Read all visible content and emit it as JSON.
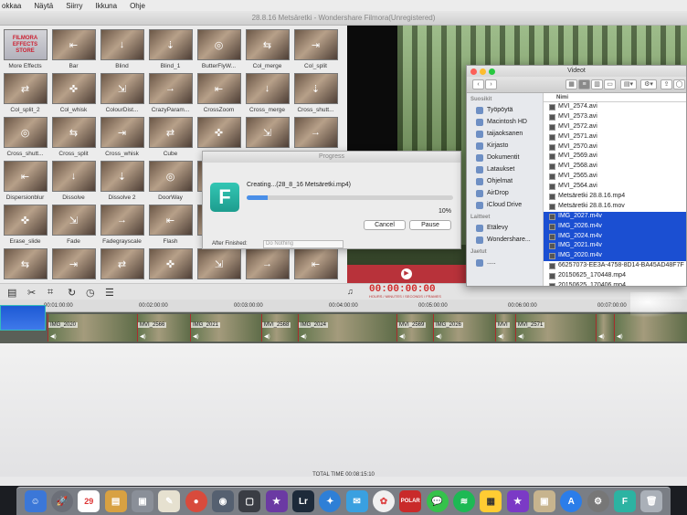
{
  "menubar": {
    "items": [
      "okkaa",
      "Näytä",
      "Siirry",
      "Ikkuna",
      "Ohje"
    ]
  },
  "app": {
    "title": "28.8.16 Metsäretki - Wondershare Filmora(Unregistered)"
  },
  "effects": [
    {
      "label": "More Effects",
      "store": "FILMORA EFFECTS STORE"
    },
    {
      "label": "Bar"
    },
    {
      "label": "Blind"
    },
    {
      "label": "Blind_1"
    },
    {
      "label": "ButterFlyW..."
    },
    {
      "label": "Col_merge"
    },
    {
      "label": "Col_split"
    },
    {
      "label": "Col_split_2"
    },
    {
      "label": "Col_whisk"
    },
    {
      "label": "ColourDist..."
    },
    {
      "label": "CrazyParam..."
    },
    {
      "label": "CrossZoom"
    },
    {
      "label": "Cross_merge"
    },
    {
      "label": "Cross_shutt..."
    },
    {
      "label": "Cross_shutt..."
    },
    {
      "label": "Cross_split"
    },
    {
      "label": "Cross_whisk"
    },
    {
      "label": "Cube"
    },
    {
      "label": ""
    },
    {
      "label": ""
    },
    {
      "label": ""
    },
    {
      "label": "Dispersionblur"
    },
    {
      "label": "Dissolve"
    },
    {
      "label": "Dissolve 2"
    },
    {
      "label": "DoorWay"
    },
    {
      "label": ""
    },
    {
      "label": ""
    },
    {
      "label": ""
    },
    {
      "label": "Erase_slide"
    },
    {
      "label": "Fade"
    },
    {
      "label": "Fadegrayscale"
    },
    {
      "label": "Flash"
    },
    {
      "label": ""
    },
    {
      "label": ""
    },
    {
      "label": ""
    },
    {
      "label": ""
    },
    {
      "label": ""
    },
    {
      "label": ""
    },
    {
      "label": ""
    },
    {
      "label": ""
    },
    {
      "label": ""
    },
    {
      "label": ""
    }
  ],
  "toolbar": {
    "timecode": "00:00:00:00",
    "timecode_units": "HOURS / MINUTES / SECONDS / FRAMES"
  },
  "ruler": [
    "00:01:00:00",
    "00:02:00:00",
    "00:03:00:00",
    "00:04:00:00",
    "00:05:00:00",
    "00:06:00:00",
    "00:07:00:00"
  ],
  "clips": [
    "IMG_2020",
    "MVI_2566",
    "IMG_2021",
    "MVI_2568",
    "IMG_2024",
    "MVI_2569",
    "IMG_2026",
    "MVI",
    "MVI_2571",
    "",
    ""
  ],
  "total_time": "TOTAL TIME 00:08:15:10",
  "progress": {
    "title": "Progress",
    "creating": "Creating...(28_8_16 Metsäretki.mp4)",
    "percent_text": "10%",
    "percent": 0.1,
    "cancel": "Cancel",
    "pause": "Pause",
    "after_label": "After Finished:",
    "after_value": "Do Nothing"
  },
  "finder": {
    "title": "Videot",
    "favorites_header": "Suosikit",
    "favorites": [
      "Työpöytä",
      "Macintosh HD",
      "taijaoksanen",
      "Kirjasto",
      "Dokumentit",
      "Lataukset",
      "Ohjelmat",
      "AirDrop",
      "iCloud Drive"
    ],
    "devices_header": "Laitteet",
    "devices": [
      "Etälevy",
      "Wondershare..."
    ],
    "shared_header": "Jaetut",
    "shared": [
      "....."
    ],
    "column_name": "Nimi",
    "files": [
      {
        "name": "MVI_2574.avi",
        "sel": false
      },
      {
        "name": "MVI_2573.avi",
        "sel": false
      },
      {
        "name": "MVI_2572.avi",
        "sel": false
      },
      {
        "name": "MVI_2571.avi",
        "sel": false
      },
      {
        "name": "MVI_2570.avi",
        "sel": false
      },
      {
        "name": "MVI_2569.avi",
        "sel": false
      },
      {
        "name": "MVI_2568.avi",
        "sel": false
      },
      {
        "name": "MVI_2565.avi",
        "sel": false
      },
      {
        "name": "MVI_2564.avi",
        "sel": false
      },
      {
        "name": "Metsäretki 28.8.16.mp4",
        "sel": false
      },
      {
        "name": "Metsäretki 28.8.16.mov",
        "sel": false
      },
      {
        "name": "IMG_2027.m4v",
        "sel": true
      },
      {
        "name": "IMG_2026.m4v",
        "sel": true
      },
      {
        "name": "IMG_2024.m4v",
        "sel": true
      },
      {
        "name": "IMG_2021.m4v",
        "sel": true
      },
      {
        "name": "IMG_2020.m4v",
        "sel": true
      },
      {
        "name": "66257073-EE3A-4758-8D14-BA45AD48F7F",
        "sel": false
      },
      {
        "name": "20150625_170448.mp4",
        "sel": false
      },
      {
        "name": "20150625_170406.mp4",
        "sel": false
      }
    ]
  },
  "dock": {
    "calendar_day": "29",
    "lr": "Lr",
    "f": "F",
    "polar": "POLAR"
  }
}
